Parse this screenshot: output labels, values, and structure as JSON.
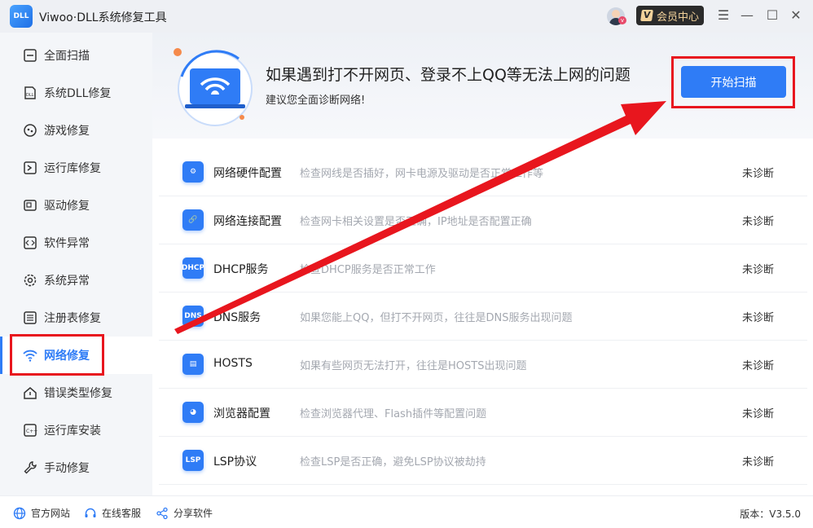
{
  "window": {
    "logo_text": "DLL",
    "title": "Viwoo·DLL系统修复工具",
    "member_label": "会员中心",
    "controls": [
      "menu",
      "minimize",
      "maximize",
      "close"
    ]
  },
  "sidebar": {
    "items": [
      {
        "label": "全面扫描",
        "icon": "scan-icon",
        "active": false
      },
      {
        "label": "系统DLL修复",
        "icon": "dll-file-icon",
        "active": false
      },
      {
        "label": "游戏修复",
        "icon": "gamepad-icon",
        "active": false
      },
      {
        "label": "运行库修复",
        "icon": "runtime-icon",
        "active": false
      },
      {
        "label": "驱动修复",
        "icon": "driver-icon",
        "active": false
      },
      {
        "label": "软件异常",
        "icon": "code-icon",
        "active": false
      },
      {
        "label": "系统异常",
        "icon": "gear-icon",
        "active": false
      },
      {
        "label": "注册表修复",
        "icon": "list-icon",
        "active": false
      },
      {
        "label": "网络修复",
        "icon": "wifi-icon",
        "active": true
      },
      {
        "label": "错误类型修复",
        "icon": "home-warning-icon",
        "active": false
      },
      {
        "label": "运行库安装",
        "icon": "install-icon",
        "active": false
      },
      {
        "label": "手动修复",
        "icon": "wrench-icon",
        "active": false
      }
    ]
  },
  "hero": {
    "title": "如果遇到打不开网页、登录不上QQ等无法上网的问题",
    "subtitle": "建议您全面诊断网络!",
    "scan_button": "开始扫描"
  },
  "checks": [
    {
      "icon_text": "⚙",
      "icon": "gear-icon",
      "name": "网络硬件配置",
      "desc": "检查网线是否插好，网卡电源及驱动是否正常工作等",
      "status": "未诊断"
    },
    {
      "icon_text": "🔗",
      "icon": "link-icon",
      "name": "网络连接配置",
      "desc": "检查网卡相关设置是否正确，IP地址是否配置正确",
      "status": "未诊断"
    },
    {
      "icon_text": "DHCP",
      "icon": "dhcp-icon",
      "name": "DHCP服务",
      "desc": "检查DHCP服务是否正常工作",
      "status": "未诊断"
    },
    {
      "icon_text": "DNS",
      "icon": "dns-icon",
      "name": "DNS服务",
      "desc": "如果您能上QQ，但打不开网页，往往是DNS服务出现问题",
      "status": "未诊断"
    },
    {
      "icon_text": "▤",
      "icon": "hosts-icon",
      "name": "HOSTS",
      "desc": "如果有些网页无法打开，往往是HOSTS出现问题",
      "status": "未诊断"
    },
    {
      "icon_text": "◕",
      "icon": "browser-icon",
      "name": "浏览器配置",
      "desc": "检查浏览器代理、Flash插件等配置问题",
      "status": "未诊断"
    },
    {
      "icon_text": "LSP",
      "icon": "lsp-icon",
      "name": "LSP协议",
      "desc": "检查LSP是否正确，避免LSP协议被劫持",
      "status": "未诊断"
    }
  ],
  "statusbar": {
    "links": [
      {
        "label": "官方网站",
        "icon": "globe-icon"
      },
      {
        "label": "在线客服",
        "icon": "headset-icon"
      },
      {
        "label": "分享软件",
        "icon": "share-icon"
      }
    ],
    "version": "版本：V3.5.0"
  },
  "colors": {
    "accent": "#2f7cf6",
    "annotation_red": "#e8161e",
    "sidebar_bg": "#f4f6f9",
    "titlebar_bg": "#eef0f4"
  }
}
